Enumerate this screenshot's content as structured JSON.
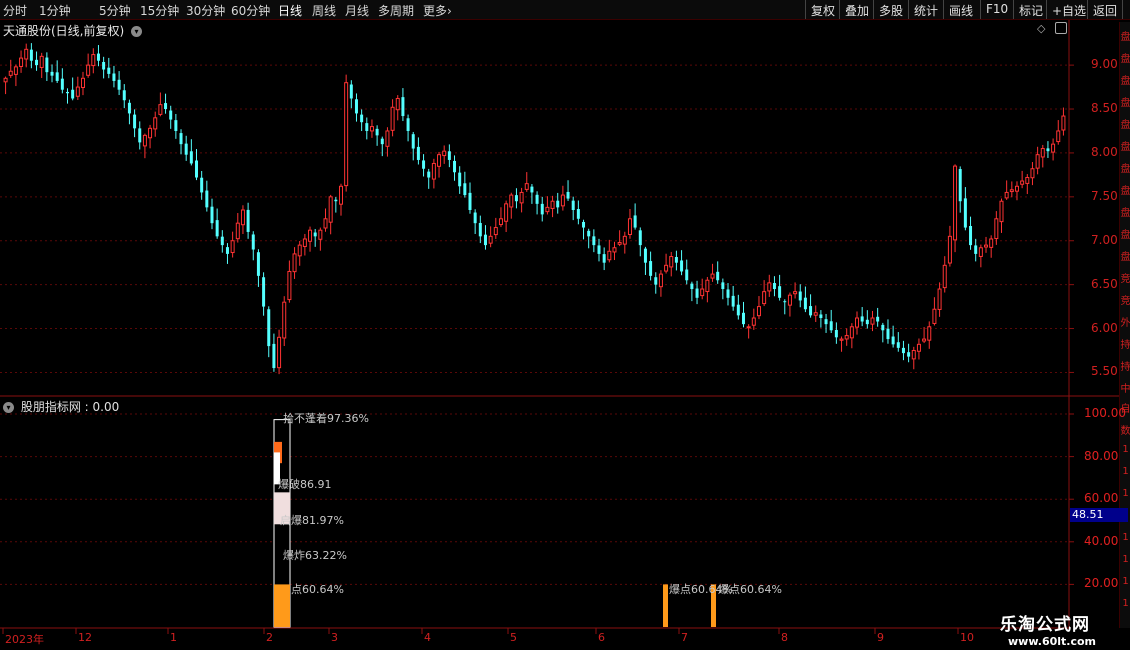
{
  "toolbar": {
    "periods": [
      "分时",
      "1分钟",
      "5分钟",
      "15分钟",
      "30分钟",
      "60分钟",
      "日线",
      "周线",
      "月线",
      "多周期",
      "更多"
    ],
    "active_period": "日线",
    "more_arrow": "›",
    "right_buttons": [
      "复权",
      "叠加",
      "多股",
      "统计",
      "画线",
      "F10",
      "标记",
      "+自选",
      "返回"
    ]
  },
  "main_chart": {
    "title": "天通股份(日线,前复权)",
    "chevron_icon": "chevron-down-icon",
    "diamond_icon": "diamond-icon",
    "window_icon": "window-icon",
    "price_axis": [
      "9.00",
      "8.50",
      "8.00",
      "7.50",
      "7.00",
      "6.50",
      "6.00",
      "5.50"
    ],
    "up_color": "#ff3333",
    "down_color": "#54ffff",
    "sidebar_chars": [
      "盘",
      "盘",
      "盘",
      "盘",
      "盘",
      "盘",
      "盘",
      "盘",
      "盘",
      "盘",
      "盘",
      "竞",
      "竞",
      "外",
      "持",
      "持",
      "中"
    ]
  },
  "indicator": {
    "title": "股朋指标网 : 0.00",
    "axis": [
      "100.00",
      "80.00",
      "60.00",
      "40.00",
      "20.00"
    ],
    "current_value": "48.51",
    "sidebar_chars": [
      "自",
      "数",
      "1",
      "1",
      "1",
      "1",
      "1",
      "1",
      "1",
      "1"
    ]
  },
  "annotations": [
    {
      "text": "拾不蓬着97.36%",
      "color": "#ffffff"
    },
    {
      "text": "爆破86.91",
      "color": "#ff6a1a"
    },
    {
      "text": "启爆81.97%",
      "color": "#ffffff"
    },
    {
      "text": "爆炸63.22%",
      "color": "#f0e0e0"
    },
    {
      "text": "点60.64%",
      "color": "#ff9a1a"
    },
    {
      "text": "爆点60.64%",
      "color": "#ff9a1a"
    },
    {
      "text": "爆点60.64%",
      "color": "#ff9a1a"
    }
  ],
  "date_axis": [
    "2023年",
    "12",
    "1",
    "2",
    "3",
    "4",
    "5",
    "6",
    "7",
    "8",
    "9",
    "10"
  ],
  "watermark": {
    "line1": "乐淘公式网",
    "line2": "www.60lt.com"
  },
  "chart_data": [
    {
      "type": "candlestick",
      "title": "天通股份(日线,前复权)",
      "ylim": [
        5.3,
        9.4
      ],
      "closes": [
        8.85,
        8.93,
        8.98,
        9.08,
        9.18,
        9.05,
        9.0,
        9.1,
        8.92,
        8.88,
        8.82,
        8.72,
        8.68,
        8.62,
        8.75,
        8.85,
        9.0,
        9.12,
        9.05,
        8.95,
        8.9,
        8.82,
        8.72,
        8.6,
        8.45,
        8.28,
        8.12,
        8.2,
        8.28,
        8.4,
        8.55,
        8.5,
        8.38,
        8.25,
        8.1,
        7.98,
        7.88,
        7.72,
        7.55,
        7.38,
        7.2,
        7.05,
        6.95,
        6.85,
        7.0,
        7.2,
        7.35,
        7.1,
        6.9,
        6.6,
        6.25,
        5.8,
        5.55,
        5.9,
        6.3,
        6.65,
        6.85,
        6.95,
        7.02,
        7.12,
        7.05,
        7.12,
        7.25,
        7.5,
        7.45,
        7.62,
        8.8,
        8.62,
        8.45,
        8.35,
        8.25,
        8.3,
        8.2,
        8.1,
        8.25,
        8.52,
        8.62,
        8.42,
        8.25,
        8.05,
        7.92,
        7.82,
        7.72,
        7.88,
        7.98,
        8.02,
        7.92,
        7.78,
        7.62,
        7.52,
        7.35,
        7.2,
        7.05,
        6.95,
        7.05,
        7.15,
        7.25,
        7.42,
        7.52,
        7.45,
        7.55,
        7.65,
        7.55,
        7.42,
        7.3,
        7.38,
        7.45,
        7.38,
        7.52,
        7.48,
        7.35,
        7.25,
        7.15,
        7.05,
        6.95,
        6.85,
        6.75,
        6.88,
        6.92,
        6.98,
        7.05,
        7.25,
        7.15,
        6.95,
        6.75,
        6.6,
        6.5,
        6.62,
        6.72,
        6.82,
        6.75,
        6.65,
        6.55,
        6.45,
        6.35,
        6.45,
        6.55,
        6.62,
        6.55,
        6.45,
        6.35,
        6.25,
        6.15,
        6.05,
        6.02,
        6.12,
        6.25,
        6.42,
        6.52,
        6.45,
        6.35,
        6.3,
        6.38,
        6.42,
        6.32,
        6.22,
        6.15,
        6.18,
        6.12,
        6.05,
        5.98,
        5.9,
        5.88,
        5.92,
        6.02,
        6.12,
        6.08,
        6.05,
        6.12,
        6.08,
        5.98,
        5.88,
        5.82,
        5.78,
        5.72,
        5.68,
        5.75,
        5.82,
        5.88,
        6.02,
        6.22,
        6.45,
        6.72,
        7.05,
        7.85,
        7.45,
        7.15,
        6.95,
        6.85,
        6.92,
        6.95,
        7.02,
        7.25,
        7.45,
        7.55,
        7.58,
        7.62,
        7.68,
        7.72,
        7.82,
        7.98,
        8.05,
        8.02,
        8.1,
        8.25,
        8.42
      ]
    },
    {
      "type": "bar",
      "title": "股朋指标网",
      "ylim": [
        0,
        100
      ],
      "bars": [
        {
          "month": "2",
          "value": 97.36,
          "color": "#ffffff",
          "label": "拾不蓬着97.36%"
        },
        {
          "month": "2",
          "value": 86.91,
          "color": "#ff6a1a",
          "label": "爆破86.91"
        },
        {
          "month": "2",
          "value": 81.97,
          "color": "#ffffff",
          "label": "启爆81.97%"
        },
        {
          "month": "2",
          "value": 63.22,
          "color": "#f0dede",
          "label": "爆炸63.22%"
        },
        {
          "month": "2",
          "value": 60.64,
          "color": "#ff9a1a",
          "label": "点60.64%"
        },
        {
          "month": "7",
          "value": 60.64,
          "color": "#ff9a1a",
          "label": "爆点60.64%"
        },
        {
          "month": "7",
          "value": 60.64,
          "color": "#ff9a1a",
          "label": "爆点60.64%"
        }
      ]
    }
  ]
}
